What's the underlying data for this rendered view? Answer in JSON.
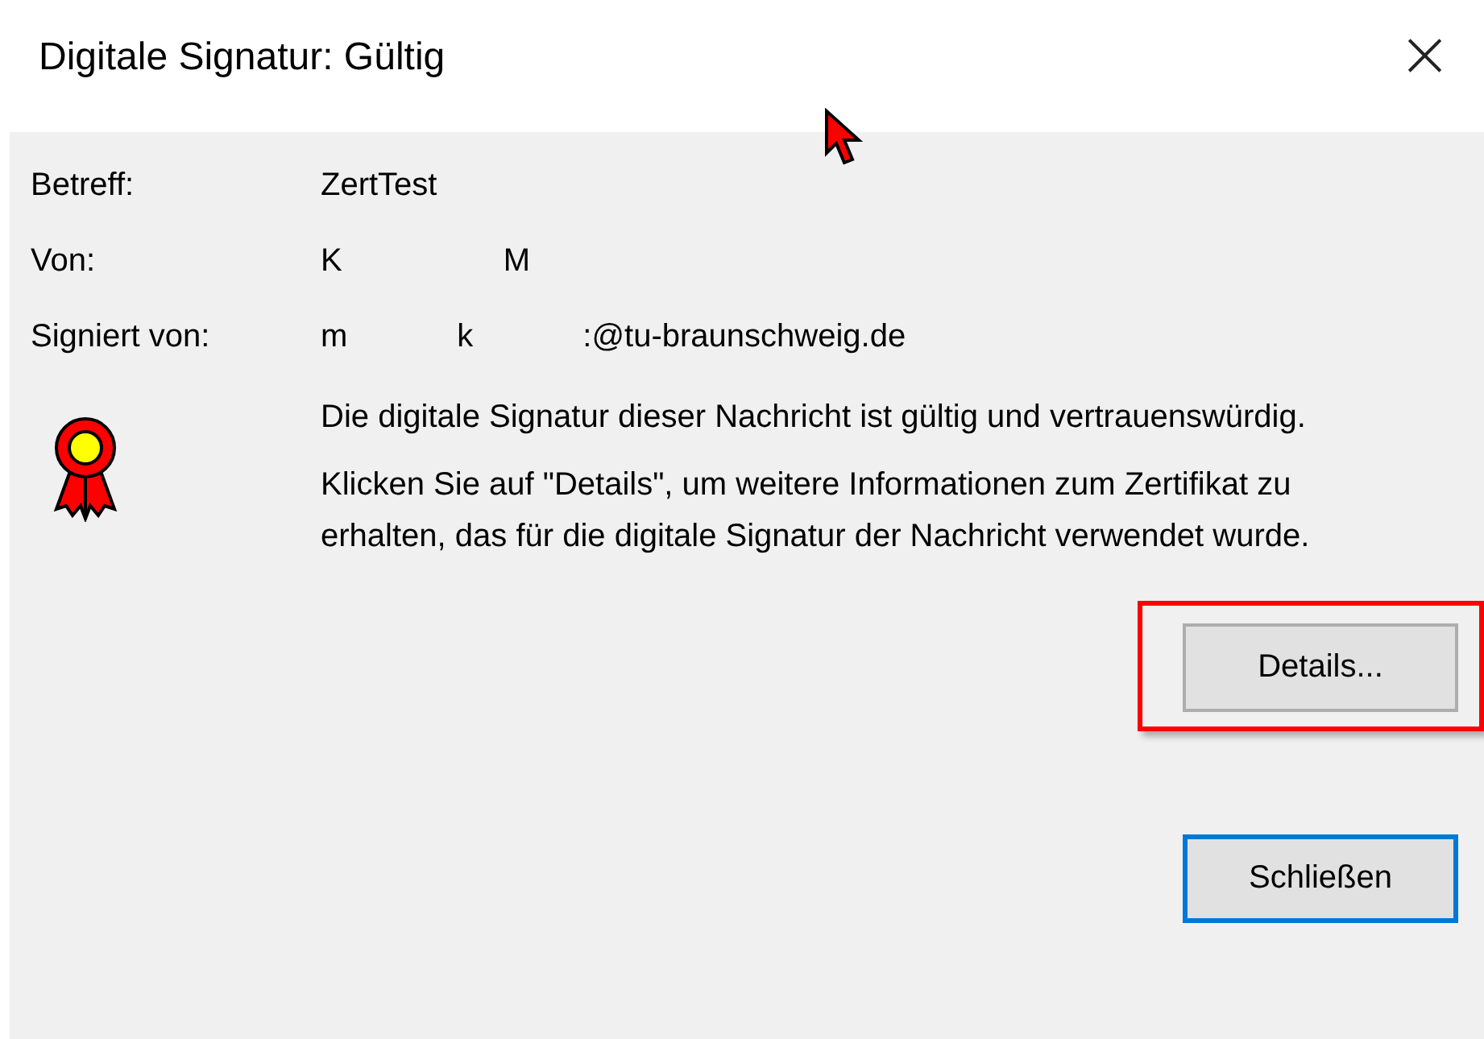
{
  "window": {
    "title": "Digitale Signatur: Gültig",
    "close": "×"
  },
  "fields": [
    {
      "label": "Betreff:",
      "parts": [
        "ZertTest"
      ]
    },
    {
      "label": "Von:",
      "parts": [
        "K",
        "M"
      ]
    },
    {
      "label": "Signiert von:",
      "parts": [
        "m",
        "k",
        ":@tu-braunschweig.de"
      ]
    }
  ],
  "messages": [
    "Die digitale Signatur dieser Nachricht ist gültig und vertrauenswürdig.",
    "Klicken Sie auf \"Details\", um weitere Informationen zum Zertifikat zu erhalten, das für die digitale Signatur der Nachricht verwendet wurde."
  ],
  "buttons": [
    {
      "label": "Details...",
      "highlighted": true,
      "default": false
    },
    {
      "label": "Schließen",
      "highlighted": false,
      "default": true
    }
  ]
}
